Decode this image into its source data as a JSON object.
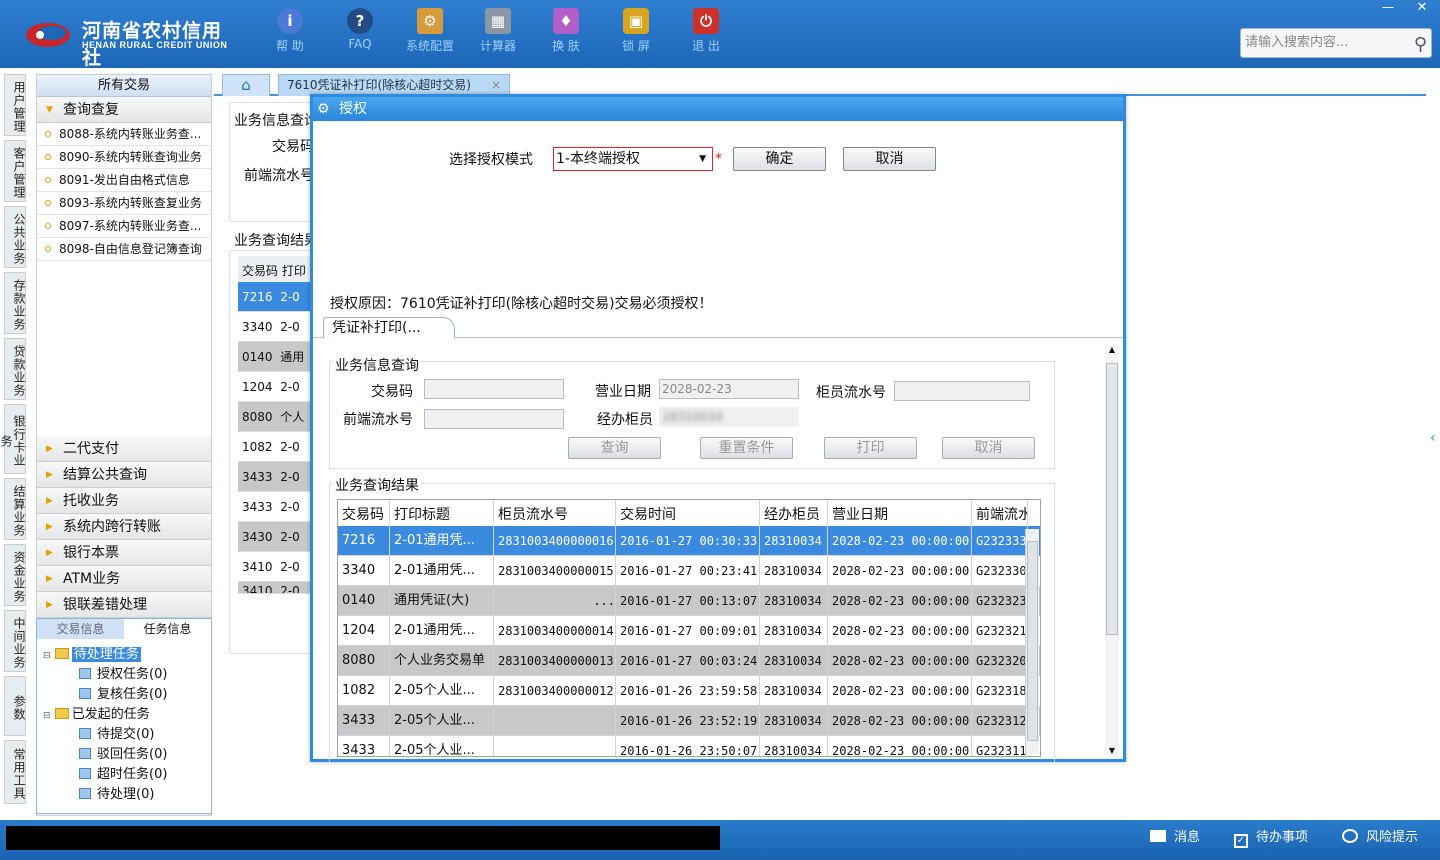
{
  "app": {
    "logo_cn": "河南省农村信用社",
    "logo_en": "HENAN RURAL CREDIT UNION",
    "toolbar": [
      {
        "icon": "info-icon",
        "label": "帮 助"
      },
      {
        "icon": "faq-icon",
        "label": "FAQ"
      },
      {
        "icon": "config-icon",
        "label": "系统配置"
      },
      {
        "icon": "calculator-icon",
        "label": "计算器"
      },
      {
        "icon": "shirt-icon",
        "label": "换 肤"
      },
      {
        "icon": "lock-icon",
        "label": "锁 屏"
      },
      {
        "icon": "power-icon",
        "label": "退 出"
      }
    ],
    "search_placeholder": "请输入搜索内容...",
    "window_min": "—",
    "window_close": "✕"
  },
  "left_vtabs": [
    "用户管理",
    "客户管理",
    "公共业务",
    "存款业务",
    "贷款业务",
    "银行卡业务",
    "结算业务",
    "资金业务",
    "中间业务",
    "参数",
    "常用工具"
  ],
  "tree": {
    "header": "所有交易",
    "open_group": "查询查复",
    "items": [
      "8088-系统内转账业务查...",
      "8090-系统内转账查询业务",
      "8091-发出自由格式信息",
      "8093-系统内转账查复业务",
      "8097-系统内转账业务查...",
      "8098-自由信息登记簿查询"
    ],
    "groups": [
      "二代支付",
      "结算公共查询",
      "托收业务",
      "系统内跨行转账",
      "银行本票",
      "ATM业务",
      "银联差错处理"
    ]
  },
  "task_panel": {
    "tab1": "交易信息",
    "tab2": "任务信息",
    "nodes": [
      {
        "label": "待处理任务",
        "level": 0,
        "folder": true
      },
      {
        "label": "授权任务(0)",
        "level": 1,
        "folder": false
      },
      {
        "label": "复核任务(0)",
        "level": 1,
        "folder": false
      },
      {
        "label": "已发起的任务",
        "level": 0,
        "folder": true
      },
      {
        "label": "待提交(0)",
        "level": 1,
        "folder": false
      },
      {
        "label": "驳回任务(0)",
        "level": 1,
        "folder": false
      },
      {
        "label": "超时任务(0)",
        "level": 1,
        "folder": false
      },
      {
        "label": "待处理(0)",
        "level": 1,
        "folder": false
      }
    ]
  },
  "tabs": {
    "home": "⌂",
    "active": "7610凭证补打印(除核心超时交易)",
    "close": "×"
  },
  "background": {
    "section1": "业务信息查询",
    "code_label": "交易码",
    "flow_label": "前端流水号",
    "section2": "业务查询结果",
    "col1": "交易码",
    "col2": "打印",
    "rows": [
      {
        "code": "7216",
        "title": "2-0"
      },
      {
        "code": "3340",
        "title": "2-0"
      },
      {
        "code": "0140",
        "title": "通用"
      },
      {
        "code": "1204",
        "title": "2-0"
      },
      {
        "code": "8080",
        "title": "个人"
      },
      {
        "code": "1082",
        "title": "2-0"
      },
      {
        "code": "3433",
        "title": "2-0"
      },
      {
        "code": "3433",
        "title": "2-0"
      },
      {
        "code": "3430",
        "title": "2-0"
      },
      {
        "code": "3410",
        "title": "2-0"
      },
      {
        "code": "3410",
        "title": "2-0"
      }
    ]
  },
  "dialog": {
    "title": "授权",
    "mode_label": "选择授权模式",
    "mode_value": "1-本终端授权",
    "required_mark": "*",
    "ok": "确定",
    "cancel": "取消",
    "reason": "授权原因：7610凭证补打印(除核心超时交易)交易必须授权！",
    "inner_tab": "凭证补打印(...",
    "section1": "业务信息查询",
    "fields": {
      "code_label": "交易码",
      "date_label": "营业日期",
      "date_value": "2028-02-23",
      "teller_flow_label": "柜员流水号",
      "front_flow_label": "前端流水号",
      "teller_label": "经办柜员",
      "teller_value": "28310034"
    },
    "buttons": {
      "query": "查询",
      "reset": "重置条件",
      "print": "打印",
      "cancel": "取消"
    },
    "section2": "业务查询结果",
    "table": {
      "headers": [
        "交易码",
        "打印标题",
        "柜员流水号",
        "交易时间",
        "经办柜员",
        "营业日期",
        "前端流水"
      ],
      "rows": [
        [
          "7216",
          "2-01通用凭...",
          "2831003400000016",
          "2016-01-27 00:30:33",
          "28310034",
          "2028-02-23 00:00:00",
          "G232333"
        ],
        [
          "3340",
          "2-01通用凭...",
          "2831003400000015",
          "2016-01-27 00:23:41",
          "28310034",
          "2028-02-23 00:00:00",
          "G232330"
        ],
        [
          "0140",
          "通用凭证(大)",
          "...",
          "2016-01-27 00:13:07",
          "28310034",
          "2028-02-23 00:00:00",
          "G232323"
        ],
        [
          "1204",
          "2-01通用凭...",
          "2831003400000014",
          "2016-01-27 00:09:01",
          "28310034",
          "2028-02-23 00:00:00",
          "G232321"
        ],
        [
          "8080",
          "个人业务交易单",
          "2831003400000013",
          "2016-01-27 00:03:24",
          "28310034",
          "2028-02-23 00:00:00",
          "G232320"
        ],
        [
          "1082",
          "2-05个人业...",
          "2831003400000012",
          "2016-01-26 23:59:58",
          "28310034",
          "2028-02-23 00:00:00",
          "G232318"
        ],
        [
          "3433",
          "2-05个人业...",
          "",
          "2016-01-26 23:52:19",
          "28310034",
          "2028-02-23 00:00:00",
          "G232312"
        ],
        [
          "3433",
          "2-05个人业...",
          "",
          "2016-01-26 23:50:07",
          "28310034",
          "2028-02-23 00:00:00",
          "G232311"
        ]
      ]
    }
  },
  "statusbar": {
    "msg": "消息",
    "todo": "待办事项",
    "risk": "风险提示"
  }
}
